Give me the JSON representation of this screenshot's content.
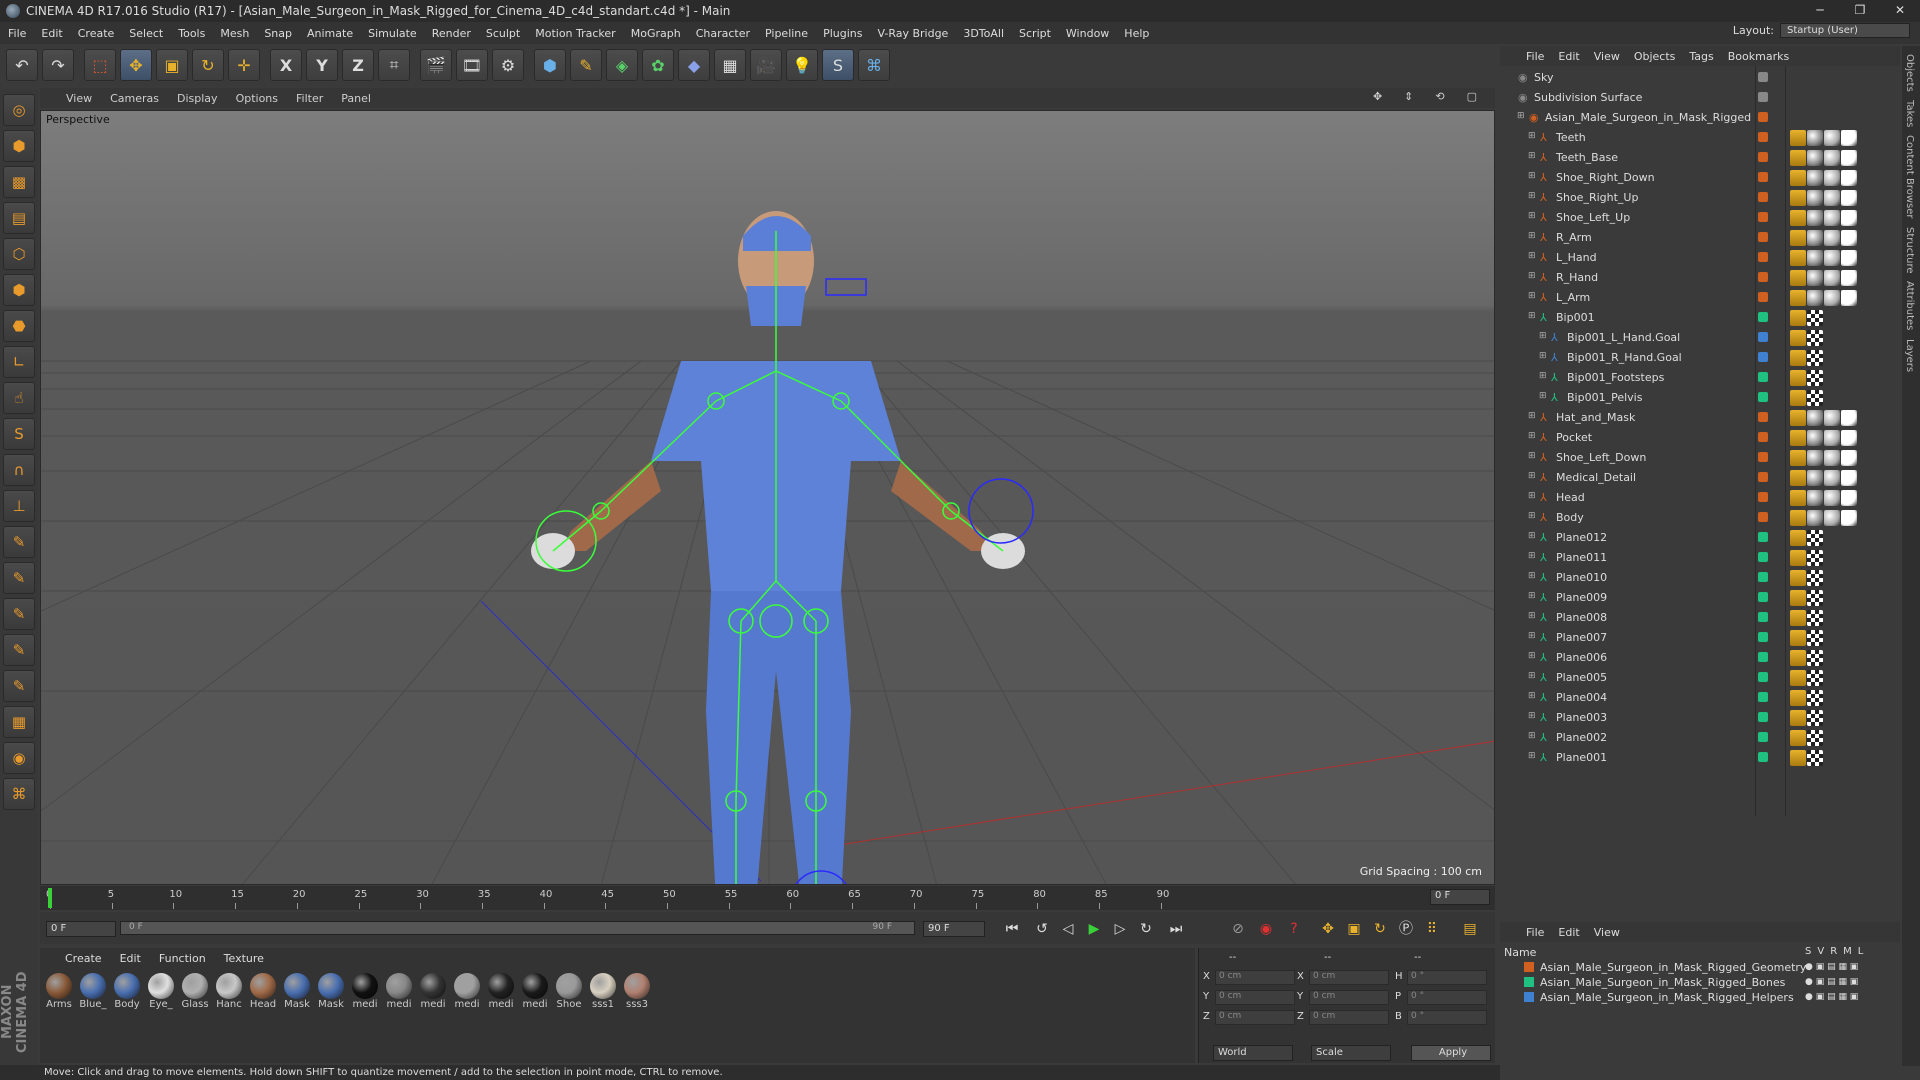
{
  "app": {
    "title": "CINEMA 4D R17.016 Studio (R17) - [Asian_Male_Surgeon_in_Mask_Rigged_for_Cinema_4D_c4d_standart.c4d *] - Main",
    "win_minimize": "─",
    "win_restore": "❐",
    "win_close": "✕"
  },
  "menu": [
    "File",
    "Edit",
    "Create",
    "Select",
    "Tools",
    "Mesh",
    "Snap",
    "Animate",
    "Simulate",
    "Render",
    "Sculpt",
    "Motion Tracker",
    "MoGraph",
    "Character",
    "Pipeline",
    "Plugins",
    "V-Ray Bridge",
    "3DToAll",
    "Script",
    "Window",
    "Help"
  ],
  "layout": {
    "label": "Layout:",
    "value": "Startup (User)"
  },
  "toolbar": {
    "axis_x": "X",
    "axis_y": "Y",
    "axis_z": "Z"
  },
  "viewport": {
    "menu": [
      "View",
      "Cameras",
      "Display",
      "Options",
      "Filter",
      "Panel"
    ],
    "label": "Perspective",
    "grid_spacing": "Grid Spacing : 100 cm"
  },
  "timeline": {
    "ticks": [
      "0",
      "5",
      "10",
      "15",
      "20",
      "25",
      "30",
      "35",
      "40",
      "45",
      "50",
      "55",
      "60",
      "65",
      "70",
      "75",
      "80",
      "85",
      "90"
    ],
    "current_frame": "0 F"
  },
  "transport": {
    "start": "0 F",
    "slider_start": "0 F",
    "slider_end": "90 F",
    "end": "90 F"
  },
  "materials": {
    "menu": [
      "Create",
      "Edit",
      "Function",
      "Texture"
    ],
    "items": [
      {
        "name": "Arms",
        "color": "#8a5a3a"
      },
      {
        "name": "Blue_",
        "color": "#4a6fb0"
      },
      {
        "name": "Body",
        "color": "#4a6fb0"
      },
      {
        "name": "Eye_",
        "color": "#e0e0e0"
      },
      {
        "name": "Glass",
        "color": "#b0b0b0"
      },
      {
        "name": "Hanc",
        "color": "#c8c8c8"
      },
      {
        "name": "Head",
        "color": "#a06a48"
      },
      {
        "name": "Mask",
        "color": "#4a6fb0"
      },
      {
        "name": "Mask",
        "color": "#4a6fb0"
      },
      {
        "name": "medi",
        "color": "#111111"
      },
      {
        "name": "medi",
        "color": "#888888"
      },
      {
        "name": "medi",
        "color": "#333333"
      },
      {
        "name": "medi",
        "color": "#a0a0a0"
      },
      {
        "name": "medi",
        "color": "#222222"
      },
      {
        "name": "medi",
        "color": "#1a1a1a"
      },
      {
        "name": "Shoe",
        "color": "#999999"
      },
      {
        "name": "sss1",
        "color": "#d8d0c0"
      },
      {
        "name": "sss3",
        "color": "#b08070"
      }
    ]
  },
  "coords": {
    "rows": [
      {
        "a": "X",
        "v1": "0 cm",
        "b": "X",
        "v2": "0 cm",
        "c": "H",
        "v3": "0 °"
      },
      {
        "a": "Y",
        "v1": "0 cm",
        "b": "Y",
        "v2": "0 cm",
        "c": "P",
        "v3": "0 °"
      },
      {
        "a": "Z",
        "v1": "0 cm",
        "b": "Z",
        "v2": "0 cm",
        "c": "B",
        "v3": "0 °"
      }
    ],
    "mode": "World",
    "scale": "Scale",
    "apply": "Apply",
    "header1": "--",
    "header2": "--",
    "header3": "--"
  },
  "status": "Move: Click and drag to move elements. Hold down SHIFT to quantize movement / add to the selection in point mode, CTRL to remove.",
  "objects": {
    "menu": [
      "File",
      "Edit",
      "View",
      "Objects",
      "Tags",
      "Bookmarks"
    ],
    "rows": [
      {
        "name": "Sky",
        "indent": 0,
        "dot": "#888888"
      },
      {
        "name": "Subdivision Surface",
        "indent": 0,
        "dot": "#888888"
      },
      {
        "name": "Asian_Male_Surgeon_in_Mask_Rigged",
        "indent": 1,
        "dot": "#d06020"
      },
      {
        "name": "Teeth",
        "indent": 2,
        "dot": "#d06020"
      },
      {
        "name": "Teeth_Base",
        "indent": 2,
        "dot": "#d06020"
      },
      {
        "name": "Shoe_Right_Down",
        "indent": 2,
        "dot": "#d06020"
      },
      {
        "name": "Shoe_Right_Up",
        "indent": 2,
        "dot": "#d06020"
      },
      {
        "name": "Shoe_Left_Up",
        "indent": 2,
        "dot": "#d06020"
      },
      {
        "name": "R_Arm",
        "indent": 2,
        "dot": "#d06020"
      },
      {
        "name": "L_Hand",
        "indent": 2,
        "dot": "#d06020"
      },
      {
        "name": "R_Hand",
        "indent": 2,
        "dot": "#d06020"
      },
      {
        "name": "L_Arm",
        "indent": 2,
        "dot": "#d06020"
      },
      {
        "name": "Bip001",
        "indent": 2,
        "dot": "#20c080"
      },
      {
        "name": "Bip001_L_Hand.Goal",
        "indent": 3,
        "dot": "#4080d0"
      },
      {
        "name": "Bip001_R_Hand.Goal",
        "indent": 3,
        "dot": "#4080d0"
      },
      {
        "name": "Bip001_Footsteps",
        "indent": 3,
        "dot": "#20c080"
      },
      {
        "name": "Bip001_Pelvis",
        "indent": 3,
        "dot": "#20c080"
      },
      {
        "name": "Hat_and_Mask",
        "indent": 2,
        "dot": "#d06020"
      },
      {
        "name": "Pocket",
        "indent": 2,
        "dot": "#d06020"
      },
      {
        "name": "Shoe_Left_Down",
        "indent": 2,
        "dot": "#d06020"
      },
      {
        "name": "Medical_Detail",
        "indent": 2,
        "dot": "#d06020"
      },
      {
        "name": "Head",
        "indent": 2,
        "dot": "#d06020"
      },
      {
        "name": "Body",
        "indent": 2,
        "dot": "#d06020"
      },
      {
        "name": "Plane012",
        "indent": 2,
        "dot": "#20c080"
      },
      {
        "name": "Plane011",
        "indent": 2,
        "dot": "#20c080"
      },
      {
        "name": "Plane010",
        "indent": 2,
        "dot": "#20c080"
      },
      {
        "name": "Plane009",
        "indent": 2,
        "dot": "#20c080"
      },
      {
        "name": "Plane008",
        "indent": 2,
        "dot": "#20c080"
      },
      {
        "name": "Plane007",
        "indent": 2,
        "dot": "#20c080"
      },
      {
        "name": "Plane006",
        "indent": 2,
        "dot": "#20c080"
      },
      {
        "name": "Plane005",
        "indent": 2,
        "dot": "#20c080"
      },
      {
        "name": "Plane004",
        "indent": 2,
        "dot": "#20c080"
      },
      {
        "name": "Plane003",
        "indent": 2,
        "dot": "#20c080"
      },
      {
        "name": "Plane002",
        "indent": 2,
        "dot": "#20c080"
      },
      {
        "name": "Plane001",
        "indent": 2,
        "dot": "#20c080"
      }
    ]
  },
  "layers": {
    "menu": [
      "File",
      "Edit",
      "View"
    ],
    "header_name": "Name",
    "header_cols": [
      "S",
      "V",
      "R",
      "M",
      "L"
    ],
    "rows": [
      {
        "name": "Asian_Male_Surgeon_in_Mask_Rigged_Geometry",
        "color": "#d06020"
      },
      {
        "name": "Asian_Male_Surgeon_in_Mask_Rigged_Bones",
        "color": "#20c080"
      },
      {
        "name": "Asian_Male_Surgeon_in_Mask_Rigged_Helpers",
        "color": "#4080d0"
      }
    ]
  },
  "sidetabs": [
    "Objects",
    "Takes",
    "Content Browser",
    "Structure",
    "Attributes",
    "Layers"
  ],
  "brand": "MAXON CINEMA 4D"
}
